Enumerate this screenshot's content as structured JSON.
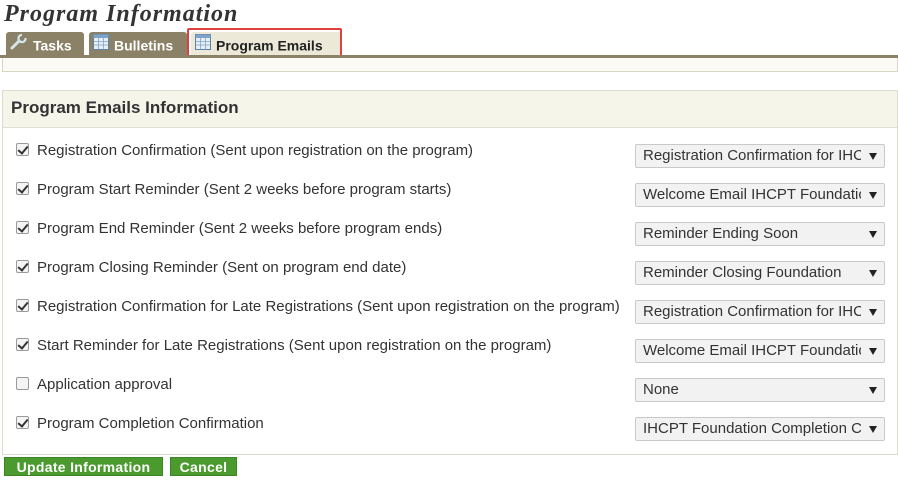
{
  "page": {
    "title": "Program Information"
  },
  "tabs": [
    {
      "label": "Tasks",
      "icon": "wrench-icon"
    },
    {
      "label": "Bulletins",
      "icon": "table-icon"
    },
    {
      "label": "Program Emails",
      "icon": "table-icon",
      "active": true
    }
  ],
  "panel": {
    "heading": "Program Emails Information",
    "rows": [
      {
        "label": "Registration Confirmation (Sent upon registration on the program)",
        "checked": true,
        "selected": "Registration Confirmation for IHCPT Foundation"
      },
      {
        "label": "Program Start Reminder (Sent 2 weeks before program starts)",
        "checked": true,
        "selected": "Welcome Email IHCPT Foundation"
      },
      {
        "label": "Program End Reminder (Sent 2 weeks before program ends)",
        "checked": true,
        "selected": "Reminder Ending Soon"
      },
      {
        "label": "Program Closing Reminder (Sent on program end date)",
        "checked": true,
        "selected": "Reminder Closing Foundation"
      },
      {
        "label": "Registration Confirmation for Late Registrations (Sent upon registration on the program)",
        "checked": true,
        "selected": "Registration Confirmation for IHCPT Foundation"
      },
      {
        "label": "Start Reminder for Late Registrations (Sent upon registration on the program)",
        "checked": true,
        "selected": "Welcome Email IHCPT Foundation"
      },
      {
        "label": "Application approval",
        "checked": false,
        "selected": "None"
      },
      {
        "label": "Program Completion Confirmation",
        "checked": true,
        "selected": "IHCPT Foundation Completion Confirmation"
      }
    ]
  },
  "actions": {
    "update_label": "Update Information",
    "cancel_label": "Cancel"
  },
  "colors": {
    "tab_bg": "#8b8166",
    "highlight": "#e0413f",
    "button_green": "#4a9a2e",
    "panel_header_bg": "#f6f5ea"
  }
}
